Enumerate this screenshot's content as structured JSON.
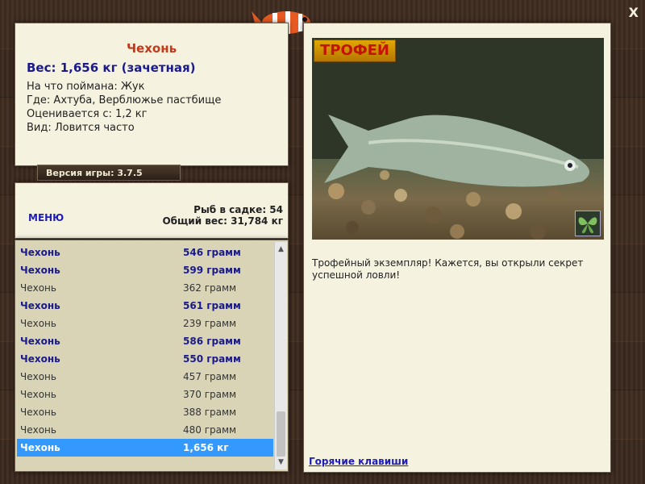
{
  "info": {
    "fish_name": "Чехонь",
    "weight_line": "Вес: 1,656 кг (зачетная)",
    "bait": "На что поймана: Жук",
    "location": "Где: Ахтуба, Верблюжье пастбище",
    "rated_from": "Оценивается с: 1,2 кг",
    "kind": "Вид: Ловится часто"
  },
  "version_label": "Версия игры: 3.7.5",
  "menu": {
    "menu_label": "МЕНЮ",
    "catch_count": "Рыб в садке: 54",
    "total_weight": "Общий вес: 31,784 кг"
  },
  "catch_list": [
    {
      "name": "Чехонь",
      "weight": "546 грамм",
      "style": "good"
    },
    {
      "name": "Чехонь",
      "weight": "599 грамм",
      "style": "good"
    },
    {
      "name": "Чехонь",
      "weight": "362 грамм",
      "style": "normal"
    },
    {
      "name": "Чехонь",
      "weight": "561 грамм",
      "style": "good"
    },
    {
      "name": "Чехонь",
      "weight": "239 грамм",
      "style": "normal"
    },
    {
      "name": "Чехонь",
      "weight": "586 грамм",
      "style": "good"
    },
    {
      "name": "Чехонь",
      "weight": "550 грамм",
      "style": "good"
    },
    {
      "name": "Чехонь",
      "weight": "457 грамм",
      "style": "normal"
    },
    {
      "name": "Чехонь",
      "weight": "370 грамм",
      "style": "normal"
    },
    {
      "name": "Чехонь",
      "weight": "388 грамм",
      "style": "normal"
    },
    {
      "name": "Чехонь",
      "weight": "480 грамм",
      "style": "normal"
    },
    {
      "name": "Чехонь",
      "weight": "1,656 кг",
      "style": "selected"
    }
  ],
  "trophy": {
    "badge": "ТРОФЕЙ",
    "description": "Трофейный экземпляр! Кажется, вы открыли секрет успешной ловли!",
    "hotkeys": "Горячие клавиши"
  },
  "close_glyph": "X",
  "icons": {
    "logo": "clownfish-logo-icon",
    "butterfly": "butterfly-icon",
    "close": "close-icon"
  }
}
